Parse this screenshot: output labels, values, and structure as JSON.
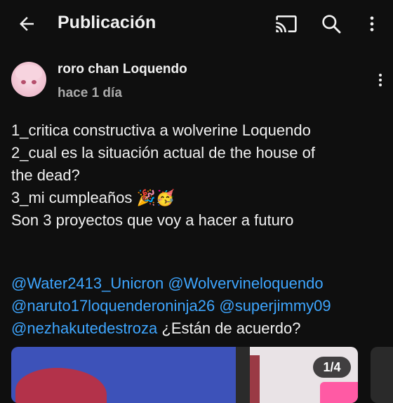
{
  "header": {
    "title": "Publicación",
    "back_icon": "arrow-back-icon",
    "cast_icon": "cast-icon",
    "search_icon": "search-icon",
    "more_icon": "more-vert-icon"
  },
  "post": {
    "author": "roro chan Loquendo",
    "time": "hace 1 día",
    "lines": [
      "1_critica constructiva a wolverine Loquendo",
      "2_cual es la situación actual de the house of",
      "the dead?",
      "3_mi cumpleaños 🎉🥳",
      "Son 3 proyectos que voy a hacer a futuro"
    ],
    "mentions": {
      "m1": "@Water2413_Unicron",
      "m2": "@Wolvervineloquendo",
      "m3": "@naruto17loquenderoninja26",
      "m4": "@superjimmy09",
      "m5": "@nezhakutedestroza",
      "tail": "¿Están de acuerdo?"
    },
    "image_counter": "1/4"
  },
  "colors": {
    "background": "#0f0f0f",
    "text": "#f1f1f1",
    "secondary": "#aaaaaa",
    "link": "#3ea6ff"
  }
}
